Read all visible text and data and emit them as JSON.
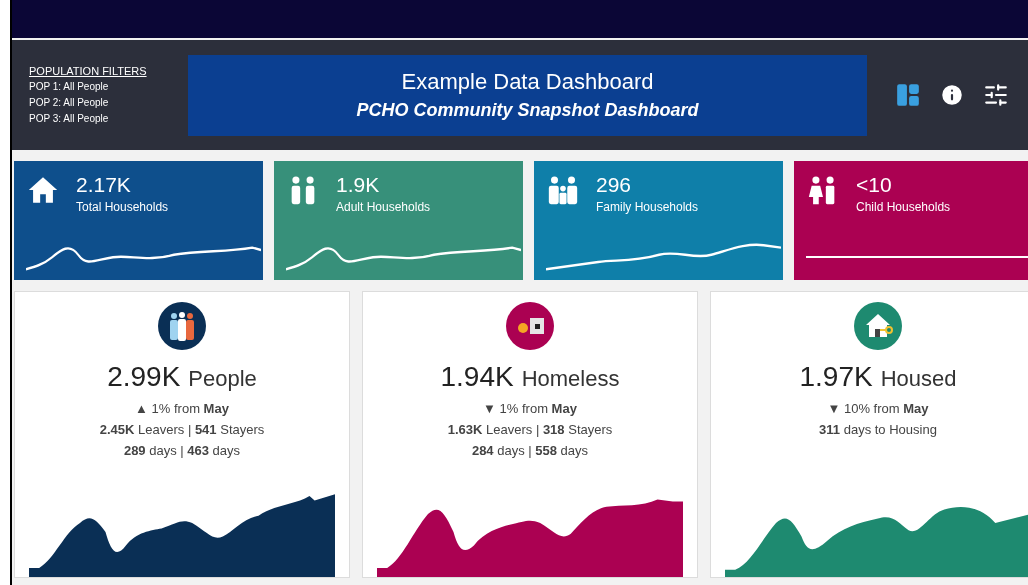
{
  "filters": {
    "heading": "POPULATION FILTERS",
    "items": [
      "POP 1: All People",
      "POP 2: All People",
      "POP 3: All People"
    ]
  },
  "title": {
    "main": "Example Data Dashboard",
    "subtitle": "PCHO Community Snapshot Dashboard"
  },
  "kpis": [
    {
      "value": "2.17K",
      "label": "Total Households",
      "color": "#0e4f8c",
      "kind": "house"
    },
    {
      "value": "1.9K",
      "label": "Adult Households",
      "color": "#37907a",
      "kind": "adults"
    },
    {
      "value": "296",
      "label": "Family Households",
      "color": "#0f7fa9",
      "kind": "family"
    },
    {
      "value": "<10",
      "label": "Child Households",
      "color": "#ab0152",
      "kind": "children"
    }
  ],
  "summaries": [
    {
      "value": "2.99K",
      "unit": "People",
      "color": "#0a2f55",
      "kind": "people",
      "lines": [
        "▲ 1% from **May**",
        "**2.45K** Leavers | **541** Stayers",
        "**289** days | **463** days"
      ]
    },
    {
      "value": "1.94K",
      "unit": "Homeless",
      "color": "#ab0152",
      "kind": "homeless",
      "lines": [
        "▼ 1% from **May**",
        "**1.63K** Leavers | **318** Stayers",
        "**284** days | **558** days"
      ]
    },
    {
      "value": "1.97K",
      "unit": "Housed",
      "color": "#1e8a70",
      "kind": "housed",
      "lines": [
        "▼ 10% from **May**",
        "**311** days to Housing"
      ]
    }
  ]
}
